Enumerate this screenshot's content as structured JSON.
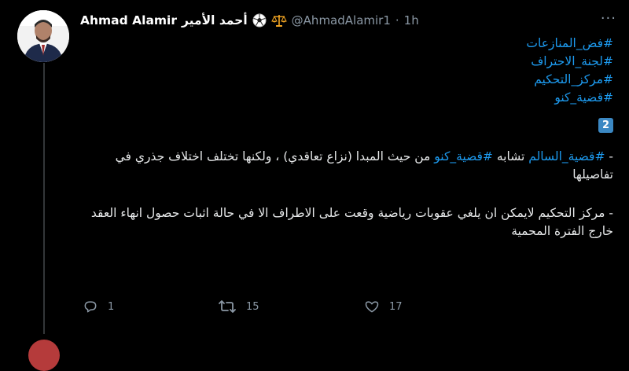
{
  "author": {
    "display_name_en": "Ahmad Alamir",
    "display_name_ar": "أحمد الأمير",
    "emoji_1": "⚽",
    "emoji_2": "⚖️",
    "handle": "@AhmadAlamir1",
    "separator": "·",
    "time": "1h"
  },
  "more_label": "···",
  "hashtags": [
    "#فض_المنازعات",
    "#لجنة_الاحتراف",
    "#مركز_التحكيم",
    "#قضية_كنو"
  ],
  "badge": "2",
  "paragraph1": {
    "prefix": "- ",
    "tag1": "#قضية_السالم",
    "mid1": " تشابه ",
    "tag2": "#قضية_كنو",
    "rest": " من حيث المبدا (نزاع تعاقدي) ، ولكنها تختلف اختلاف جذري في تفاصيلها"
  },
  "paragraph2": "- مركز التحكيم لايمكن ان يلغي عقوبات رياضية وقعت على الاطراف الا في حالة اثبات حصول انهاء العقد خارج الفترة المحمية",
  "actions": {
    "replies": "1",
    "retweets": "15",
    "likes": "17"
  },
  "colors": {
    "background": "#000000",
    "hashtag": "#1d9bf0",
    "muted": "#8b98a5",
    "badge": "#3b88c3"
  }
}
